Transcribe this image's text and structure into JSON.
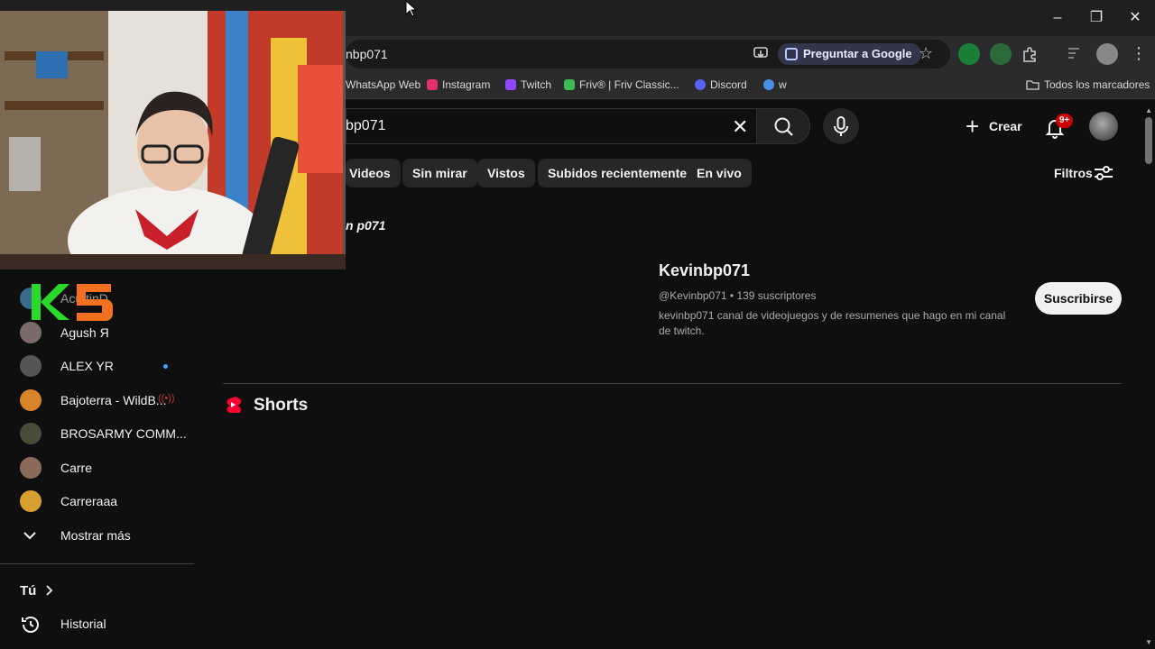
{
  "browser": {
    "url_text": "nbp071",
    "ask_google_label": "Preguntar a Google",
    "bookmarks": [
      {
        "label": "WhatsApp Web",
        "color": "#25d366"
      },
      {
        "label": "Instagram",
        "color": "#e1306c"
      },
      {
        "label": "Twitch",
        "color": "#9146ff"
      },
      {
        "label": "Friv® | Friv Classic...",
        "color": "#3cba54"
      },
      {
        "label": "Discord",
        "color": "#5865f2"
      },
      {
        "label": "w",
        "color": "#4a90e2"
      }
    ],
    "all_bookmarks_label": "Todos los marcadores"
  },
  "youtube": {
    "search_query": "bp071",
    "create_label": "Crear",
    "notifications_badge": "9+",
    "chips": [
      "Videos",
      "Sin mirar",
      "Vistos",
      "Subidos recientemente",
      "En vivo"
    ],
    "filters_label": "Filtros",
    "query_echo": "n p071",
    "channel": {
      "name": "Kevinbp071",
      "meta": "@Kevinbp071 • 139 suscriptores",
      "description": "kevinbp071 canal de videojuegos y de resumenes que hago en mi canal de twitch.",
      "subscribe_label": "Suscribirse"
    },
    "shorts_title": "Shorts"
  },
  "sidebar": {
    "subscriptions": [
      {
        "label": "AcuttinD",
        "color": "#3a6b8c",
        "indicator": ""
      },
      {
        "label": "Agush Я",
        "color": "#7a6a6a",
        "indicator": ""
      },
      {
        "label": "ALEX YR",
        "color": "#555555",
        "indicator": "dot"
      },
      {
        "label": "Bajoterra - WildB...",
        "color": "#d9842b",
        "indicator": "live"
      },
      {
        "label": "BROSARMY COMM...",
        "color": "#4a4a3a",
        "indicator": ""
      },
      {
        "label": "Carre",
        "color": "#8a6a5a",
        "indicator": ""
      },
      {
        "label": "Carreraaa",
        "color": "#d9a030",
        "indicator": ""
      }
    ],
    "show_more_label": "Mostrar más",
    "you_label": "Tú",
    "history_label": "Historial"
  },
  "colors": {
    "accent_red": "#cc0000",
    "link_blue": "#3ea6ff"
  }
}
